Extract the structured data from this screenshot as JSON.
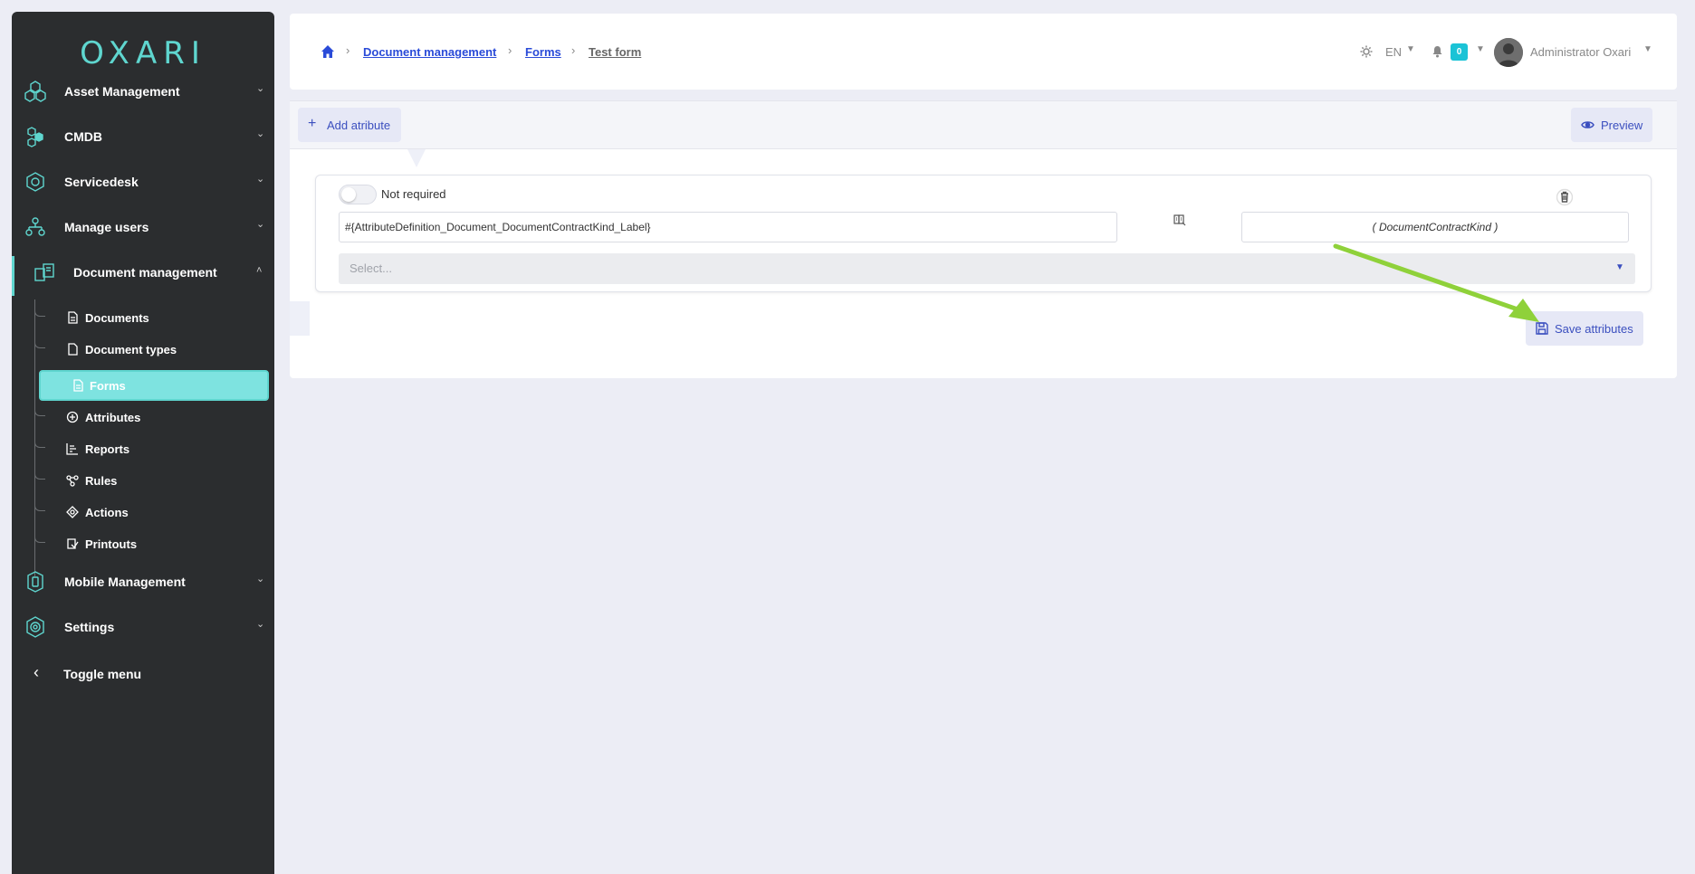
{
  "sidebar": {
    "logo": "OXARI",
    "items": [
      {
        "label": "Asset Management",
        "icon": "hexagons-icon"
      },
      {
        "label": "CMDB",
        "icon": "cmdb-hexagons-icon"
      },
      {
        "label": "Servicedesk",
        "icon": "servicedesk-icon"
      },
      {
        "label": "Manage users",
        "icon": "users-tree-icon"
      },
      {
        "label": "Document management",
        "icon": "documents-icon"
      },
      {
        "label": "Mobile Management",
        "icon": "mobile-icon"
      },
      {
        "label": "Settings",
        "icon": "settings-gear-icon"
      }
    ],
    "subitems": [
      {
        "label": "Documents",
        "icon": "document-icon"
      },
      {
        "label": "Document types",
        "icon": "document-type-icon"
      },
      {
        "label": "Forms",
        "icon": "form-icon"
      },
      {
        "label": "Attributes",
        "icon": "attributes-icon"
      },
      {
        "label": "Reports",
        "icon": "reports-icon"
      },
      {
        "label": "Rules",
        "icon": "rules-icon"
      },
      {
        "label": "Actions",
        "icon": "actions-icon"
      },
      {
        "label": "Printouts",
        "icon": "printouts-icon"
      }
    ],
    "toggle_menu": "Toggle menu"
  },
  "header": {
    "breadcrumb": [
      "Document management",
      "Forms",
      "Test form"
    ],
    "language": "EN",
    "notification_count": "0",
    "user_name": "Administrator Oxari"
  },
  "toolbar": {
    "add_attribute": "Add atribute",
    "preview": "Preview"
  },
  "attribute_card": {
    "required_label": "Not required",
    "label_value": "#{AttributeDefinition_Document_DocumentContractKind_Label}",
    "kind_value": "( DocumentContractKind )",
    "select_placeholder": "Select..."
  },
  "actions": {
    "save_attributes": "Save attributes"
  },
  "colors": {
    "accent": "#5fd6cf",
    "link": "#2a4bd8",
    "button_text": "#3b4fbf",
    "arrow": "#8fd13a"
  }
}
